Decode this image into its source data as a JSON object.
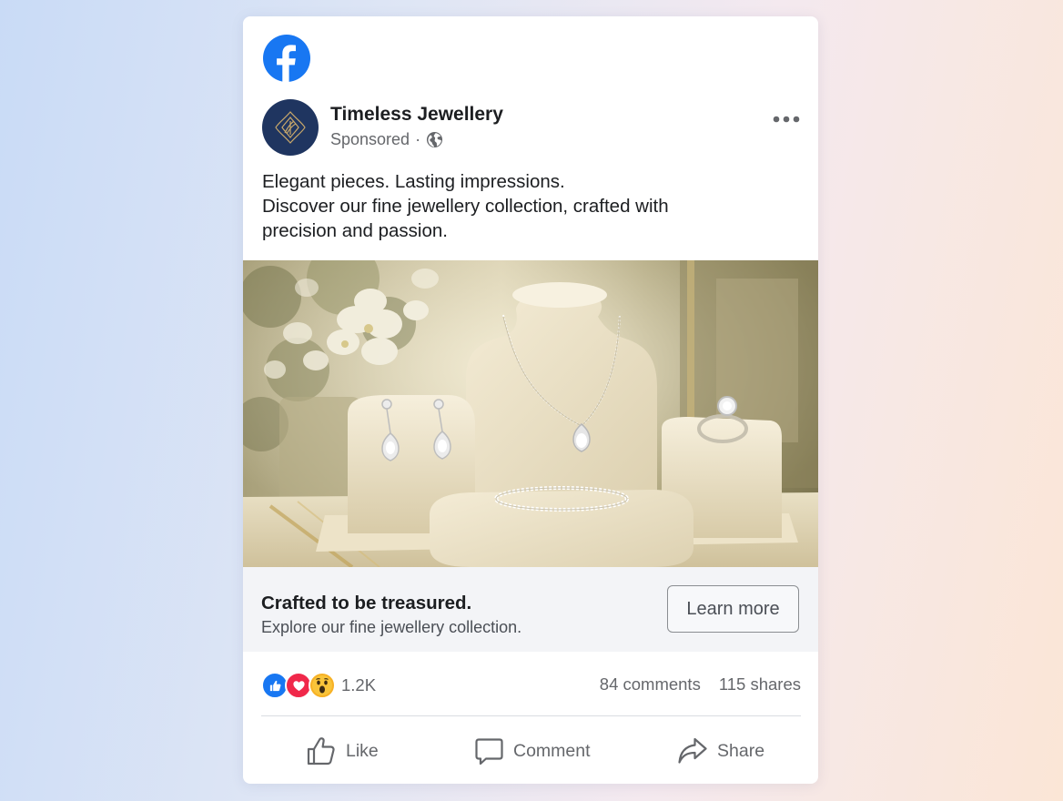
{
  "post": {
    "page_name": "Timeless Jewellery",
    "sponsored_label": "Sponsored",
    "separator": "·",
    "text_lines": [
      "Elegant pieces. Lasting impressions.",
      "Discover our fine jewellery collection, crafted with",
      "precision and passion."
    ]
  },
  "cta": {
    "title": "Crafted to be treasured.",
    "subtitle": "Explore our fine jewellery collection.",
    "button_label": "Learn more"
  },
  "stats": {
    "reaction_count": "1.2K",
    "comments": "84 comments",
    "shares": "115 shares"
  },
  "actions": {
    "like": "Like",
    "comment": "Comment",
    "share": "Share"
  },
  "icons": {
    "brand": "facebook-logo-icon",
    "avatar": "jewellery-monogram-icon",
    "audience": "globe-icon",
    "menu": "more-horizontal-icon",
    "reactions": [
      "like-reaction-icon",
      "love-reaction-icon",
      "wow-reaction-icon"
    ],
    "action_icons": [
      "thumbs-up-icon",
      "comment-icon",
      "share-arrow-icon"
    ]
  },
  "colors": {
    "facebook_blue": "#1877f2",
    "avatar_navy": "#1f3560",
    "love_red": "#f0284a",
    "wow_yellow": "#f7b125",
    "text_primary": "#1c1e21",
    "text_secondary": "#65676b"
  }
}
